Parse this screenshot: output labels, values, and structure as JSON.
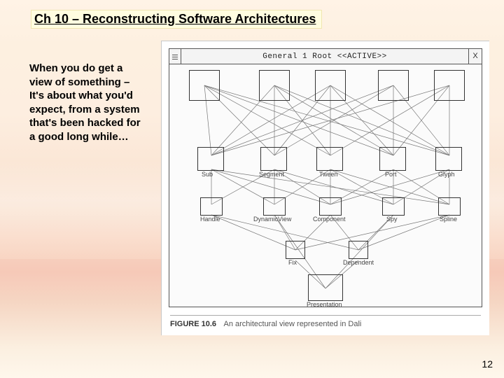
{
  "title": "Ch 10 – Reconstructing Software Architectures",
  "body": "When you do get a view of something – It's about what you'd expect, from a system that's been hacked for a good long while…",
  "figure": {
    "window_title": "General   1 Root  <<ACTIVE>>",
    "close_glyph": "X",
    "caption_label": "FIGURE 10.6",
    "caption_text": "An architectural view represented in Dali",
    "nodes_row2": [
      "Sub",
      "Segment",
      "Tween",
      "Port",
      "Glyph"
    ],
    "nodes_row3": [
      "Handle",
      "DynamicView",
      "Component",
      "Spy",
      "Spline"
    ],
    "nodes_row4": [
      "Fix",
      "Dependent"
    ],
    "nodes_row5": [
      "Presentation"
    ]
  },
  "page_number": "12"
}
